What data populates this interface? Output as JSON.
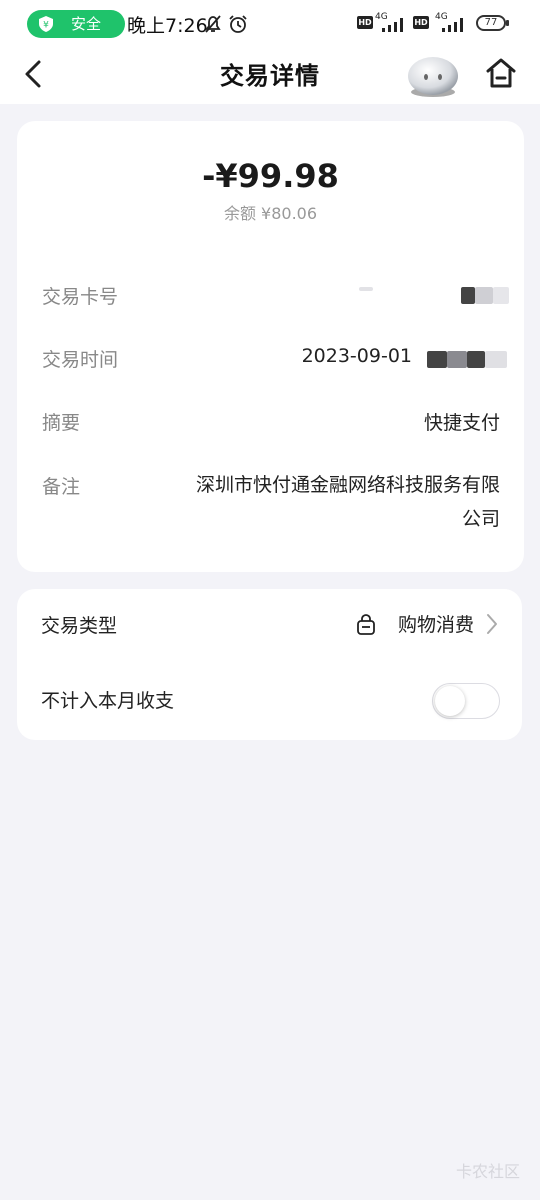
{
  "status_bar": {
    "safe_label": "安全",
    "time": "晚上7:26",
    "hd": "HD",
    "network": "4G",
    "battery": "77"
  },
  "navbar": {
    "title": "交易详情"
  },
  "transaction": {
    "amount": "-¥99.98",
    "balance": "余额 ¥80.06",
    "rows": {
      "card_no_label": "交易卡号",
      "time_label": "交易时间",
      "time_value": "2023-09-01",
      "summary_label": "摘要",
      "summary_value": "快捷支付",
      "remark_label": "备注",
      "remark_value": "深圳市快付通金融网络科技服务有限公司"
    }
  },
  "classification": {
    "type_label": "交易类型",
    "type_value": "购物消费",
    "exclude_label": "不计入本月收支",
    "exclude_enabled": false
  },
  "watermark": "卡农社区",
  "colors": {
    "safe_green": "#1fc36b",
    "page_bg": "#f3f3f8",
    "label_gray": "#888888"
  }
}
